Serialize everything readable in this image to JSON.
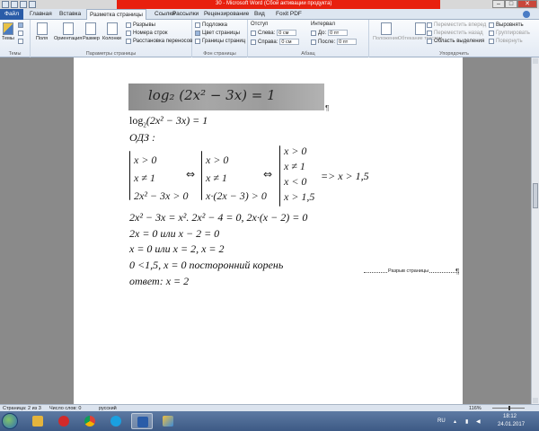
{
  "window": {
    "title": "30 - Microsoft Word (Сбой активации продукта)",
    "controls": {
      "minimize": "–",
      "maximize": "□",
      "close": "✕"
    }
  },
  "tabs": [
    "Файл",
    "Главная",
    "Вставка",
    "Разметка страницы",
    "Ссылки",
    "Рассылки",
    "Рецензирование",
    "Вид",
    "Foxit PDF"
  ],
  "ribbon": {
    "themes": {
      "button": "Темы",
      "group": "Темы"
    },
    "page_setup": {
      "buttons": [
        "Поля",
        "Ориентация",
        "Размер",
        "Колонки"
      ],
      "breaks": "Разрывы",
      "line_numbers": "Номера строк",
      "hyphenation": "Расстановка переносов",
      "group": "Параметры страницы"
    },
    "page_background": {
      "watermark": "Подложка",
      "page_color": "Цвет страницы",
      "page_borders": "Границы страниц",
      "group": "Фон страницы"
    },
    "paragraph": {
      "indent_label": "Отступ",
      "left_label": "Слева:",
      "left_value": "0 см",
      "right_label": "Справа:",
      "right_value": "0 см",
      "spacing_label": "Интервал",
      "before_label": "До:",
      "before_value": "0 пт",
      "after_label": "После:",
      "after_value": "0 пт",
      "group": "Абзац"
    },
    "arrange": {
      "position": "Положение",
      "wrap": "Обтекание текстом",
      "forward": "Переместить вперед",
      "backward": "Переместить назад",
      "selection_pane": "Область выделения",
      "align": "Выровнять",
      "group_btn": "Группировать",
      "rotate": "Повернуть",
      "group": "Упорядочить"
    }
  },
  "document": {
    "photo_handwriting": "log₂ (2x² − 3x) = 1",
    "line1_log": "log",
    "line1_sub": "2",
    "line1_rest": "(2x² − 3x) = 1",
    "odz": "ОДЗ :",
    "system1": [
      "x > 0",
      "x ≠ 1",
      "2x² − 3x > 0"
    ],
    "arrow": "⇔",
    "system2": [
      "x > 0",
      "x ≠ 1",
      "x·(2x − 3) > 0"
    ],
    "system3": [
      "x > 0",
      "x ≠ 1",
      "x < 0",
      "x > 1,5"
    ],
    "implies": "=> x > 1,5",
    "eq1": "2x² − 3x = x².   2x² − 4 = 0,   2x·(x − 2) = 0",
    "eq2": "2x = 0 или x − 2 = 0",
    "eq3": "x = 0 или x = 2, x = 2",
    "eq4": "0 <1,5,   x = 0 посторонний корень",
    "answer": "ответ:   x = 2",
    "page_break": "Разрыв страницы",
    "pilcrow": "¶"
  },
  "status": {
    "page": "Страница: 2 из 3",
    "words": "Число слов: 0",
    "language": "русский",
    "zoom": "116%"
  },
  "taskbar": {
    "apps": [
      "explorer",
      "opera",
      "chrome",
      "skype",
      "word",
      "paint"
    ],
    "lang": "RU",
    "time": "18:12",
    "date": "24.01.2017"
  }
}
